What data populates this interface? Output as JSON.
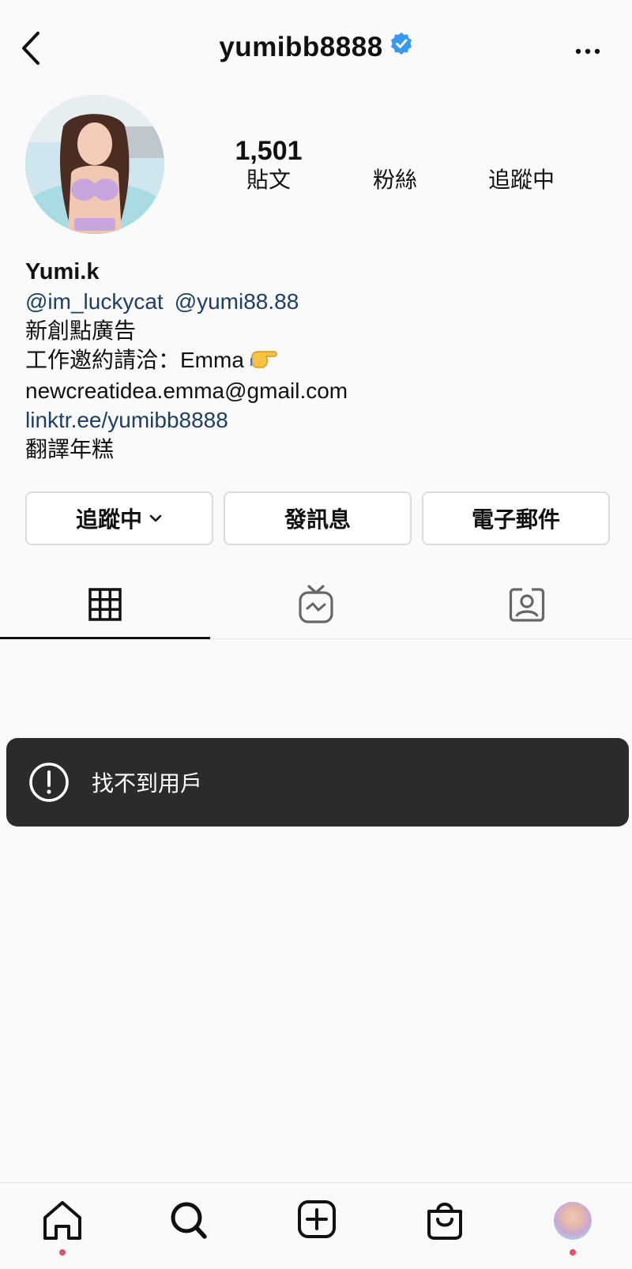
{
  "header": {
    "username": "yumibb8888",
    "verified": true
  },
  "stats": [
    {
      "value": "1,501",
      "label": "貼文"
    },
    {
      "value": "",
      "label": "粉絲"
    },
    {
      "value": "",
      "label": "追蹤中"
    }
  ],
  "bio": {
    "name": "Yumi.k",
    "mentions": [
      "@im_luckycat",
      "@yumi88.88"
    ],
    "line1": "新創點廣告",
    "line2": "工作邀約請洽：Emma",
    "email": "newcreatidea.emma@gmail.com",
    "link": "linktr.ee/yumibb8888",
    "line5": "翻譯年糕"
  },
  "actions": {
    "following": "追蹤中",
    "message": "發訊息",
    "email": "電子郵件"
  },
  "tabs": [
    {
      "icon": "grid-icon",
      "active": true
    },
    {
      "icon": "igtv-icon",
      "active": false
    },
    {
      "icon": "tagged-icon",
      "active": false
    }
  ],
  "toast": {
    "icon": "alert-icon",
    "message": "找不到用戶"
  },
  "bottom_nav": [
    "home-icon",
    "search-icon",
    "new-post-icon",
    "shop-icon",
    "profile-avatar"
  ],
  "colors": {
    "link": "#1d3f66",
    "verified": "#3897f0",
    "toast_bg": "#2b2b2d",
    "badge_dot": "#e0506b"
  }
}
